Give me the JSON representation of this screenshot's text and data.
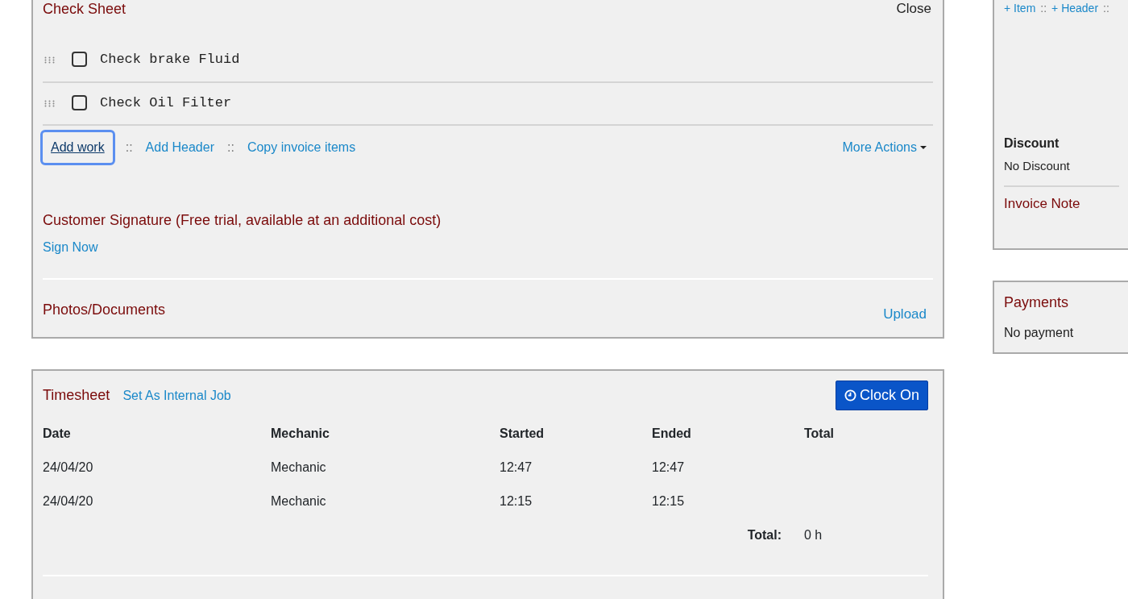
{
  "check_sheet": {
    "title": "Check Sheet",
    "close": "Close",
    "items": [
      {
        "label": "Check brake Fluid",
        "checked": false
      },
      {
        "label": "Check Oil Filter",
        "checked": false
      }
    ],
    "actions": [
      {
        "label": "Add work",
        "focused": true
      },
      {
        "label": "Add Header",
        "focused": false
      },
      {
        "label": "Copy invoice items",
        "focused": false
      }
    ],
    "action_separator": "::",
    "more_actions": "More Actions",
    "signature_title": "Customer Signature (Free trial, available at an additional cost)",
    "sign_now": "Sign Now",
    "photos_title": "Photos/Documents",
    "upload": "Upload"
  },
  "timesheet": {
    "title": "Timesheet",
    "internal_job": "Set As Internal Job",
    "clock_on": "Clock On",
    "columns": [
      "Date",
      "Mechanic",
      "Started",
      "Ended",
      "Total"
    ],
    "rows": [
      [
        "24/04/20",
        "Mechanic",
        "12:47",
        "12:47",
        ""
      ],
      [
        "24/04/20",
        "Mechanic",
        "12:15",
        "12:15",
        ""
      ]
    ],
    "total_label": "Total:",
    "total_value": "0 h"
  },
  "invoice_panel": {
    "links": [
      "+ Item",
      "+ Header"
    ],
    "link_separator": "::",
    "discount_label": "Discount",
    "discount_value": "No Discount",
    "note_title": "Invoice Note"
  },
  "payments": {
    "title": "Payments",
    "value": "No payment"
  }
}
